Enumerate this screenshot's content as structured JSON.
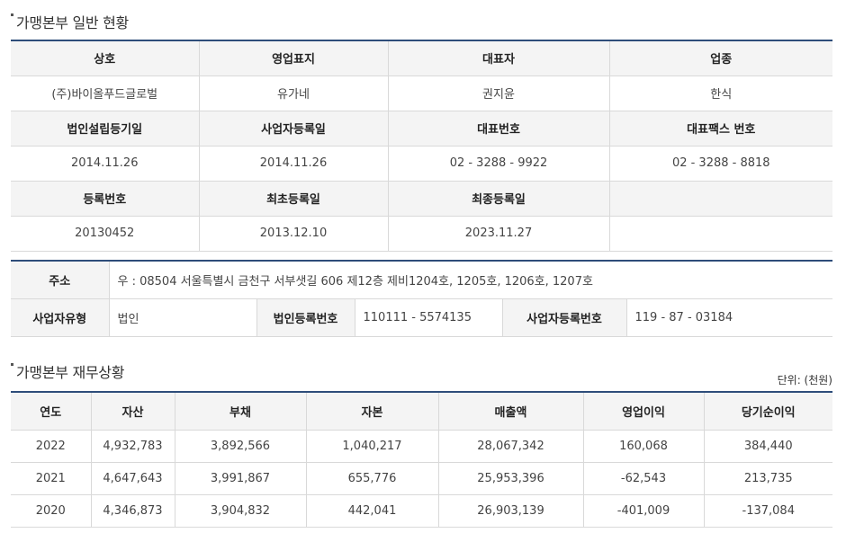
{
  "section1": {
    "title": "가맹본부 일반 현황"
  },
  "info": {
    "headers1": [
      "상호",
      "영업표지",
      "대표자",
      "업종"
    ],
    "values1": [
      "(주)바이올푸드글로벌",
      "유가네",
      "권지윤",
      "한식"
    ],
    "headers2": [
      "법인설립등기일",
      "사업자등록일",
      "대표번호",
      "대표팩스 번호"
    ],
    "values2": [
      "2014.11.26",
      "2014.11.26",
      "02 - 3288 - 9922",
      "02 - 3288 - 8818"
    ],
    "headers3": [
      "등록번호",
      "최초등록일",
      "최종등록일",
      ""
    ],
    "values3": [
      "20130452",
      "2013.12.10",
      "2023.11.27",
      ""
    ]
  },
  "address": {
    "label": "주소",
    "value": "우 : 08504 서울특별시 금천구 서부샛길 606 제12층 제비1204호, 1205호, 1206호, 1207호",
    "biz_type_label": "사업자유형",
    "biz_type_value": "법인",
    "corp_no_label": "법인등록번호",
    "corp_no_value": "110111 - 5574135",
    "biz_no_label": "사업자등록번호",
    "biz_no_value": "119 - 87 - 03184"
  },
  "section2": {
    "title": "가맹본부 재무상황",
    "unit": "단위: (천원)"
  },
  "finance": {
    "headers": [
      "연도",
      "자산",
      "부채",
      "자본",
      "매출액",
      "영업이익",
      "당기순이익"
    ],
    "rows": [
      [
        "2022",
        "4,932,783",
        "3,892,566",
        "1,040,217",
        "28,067,342",
        "160,068",
        "384,440"
      ],
      [
        "2021",
        "4,647,643",
        "3,991,867",
        "655,776",
        "25,953,396",
        "-62,543",
        "213,735"
      ],
      [
        "2020",
        "4,346,873",
        "3,904,832",
        "442,041",
        "26,903,139",
        "-401,009",
        "-137,084"
      ]
    ]
  }
}
